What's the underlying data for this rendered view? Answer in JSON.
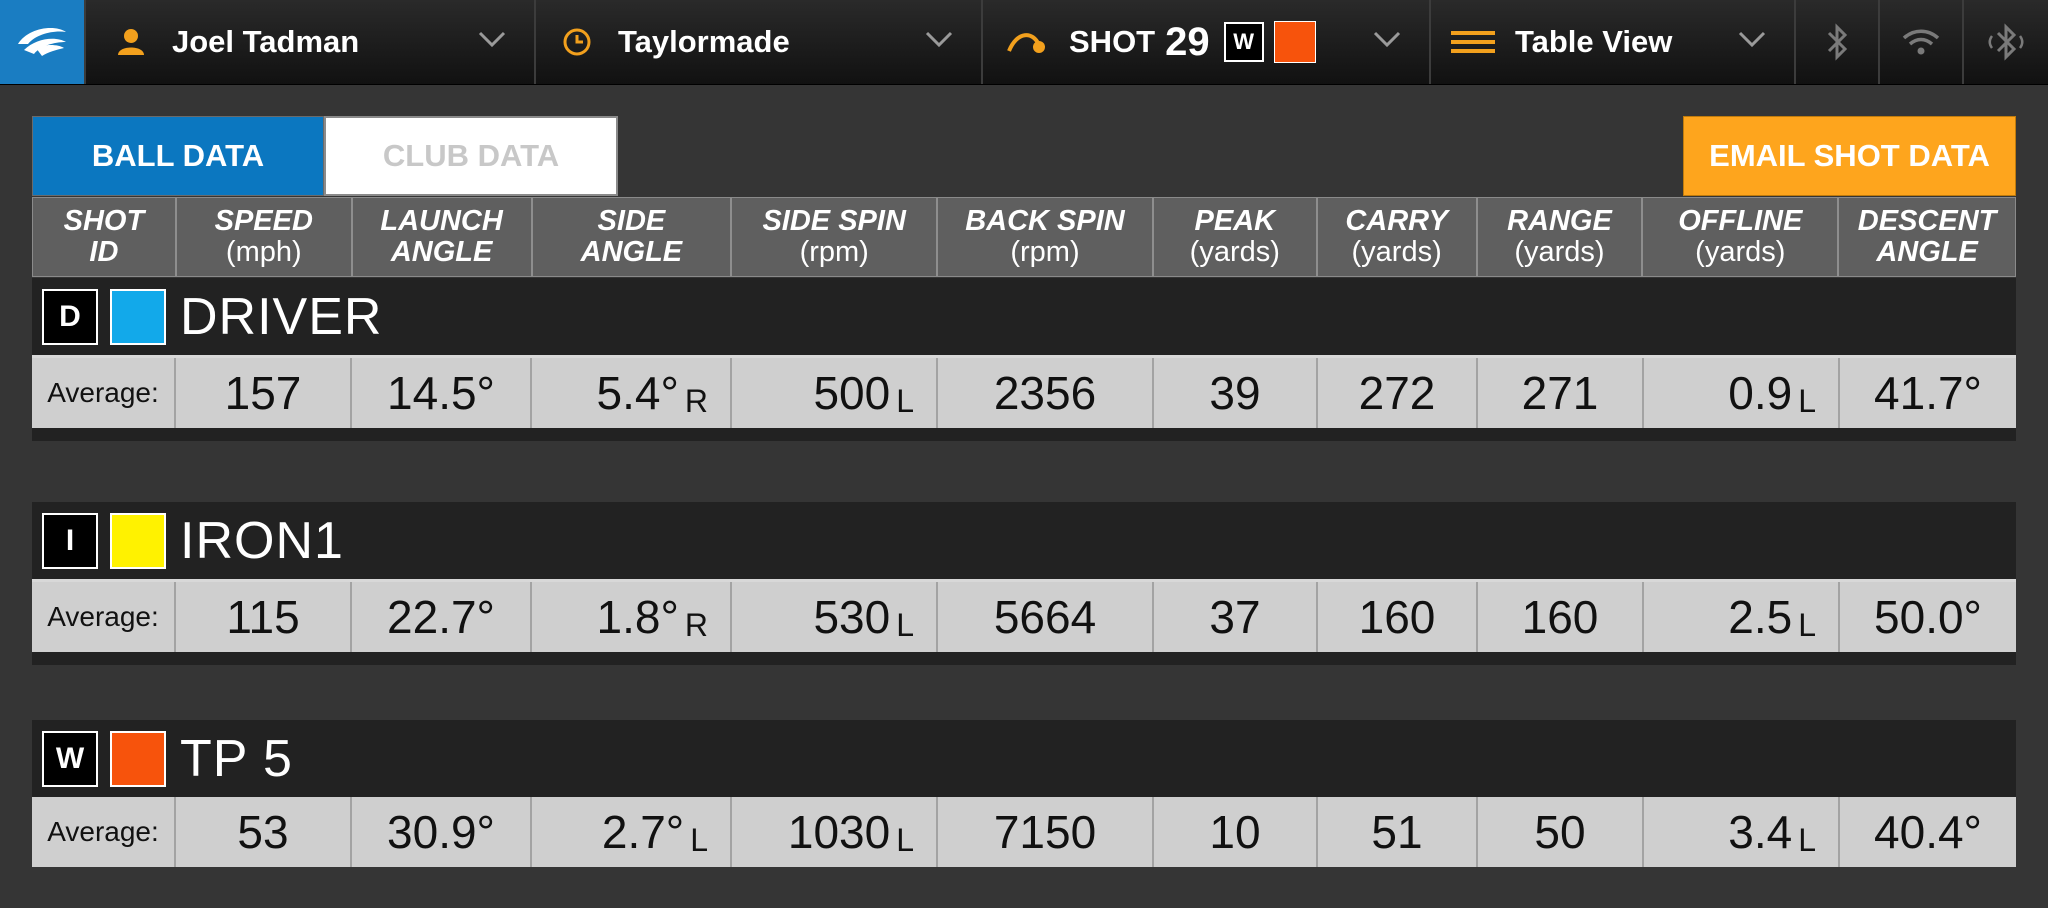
{
  "topbar": {
    "user_name": "Joel Tadman",
    "session_name": "Taylormade",
    "shot_label": "SHOT",
    "shot_number": "29",
    "shot_club_id": "W",
    "view_name": "Table View"
  },
  "tabs": {
    "ball": "BALL DATA",
    "club": "CLUB DATA"
  },
  "email_button": "EMAIL SHOT DATA",
  "columns": [
    {
      "title": "SHOT",
      "unit": "ID"
    },
    {
      "title": "SPEED",
      "unit": "(mph)"
    },
    {
      "title": "LAUNCH",
      "unit": "ANGLE"
    },
    {
      "title": "SIDE",
      "unit": "ANGLE"
    },
    {
      "title": "SIDE SPIN",
      "unit": "(rpm)"
    },
    {
      "title": "BACK SPIN",
      "unit": "(rpm)"
    },
    {
      "title": "PEAK",
      "unit": "(yards)"
    },
    {
      "title": "CARRY",
      "unit": "(yards)"
    },
    {
      "title": "RANGE",
      "unit": "(yards)"
    },
    {
      "title": "OFFLINE",
      "unit": "(yards)"
    },
    {
      "title": "DESCENT",
      "unit": "ANGLE"
    }
  ],
  "clubs": [
    {
      "id": "D",
      "name": "DRIVER",
      "color": "#12a9ea",
      "average_label": "Average:",
      "speed": "157",
      "launch": "14.5°",
      "side_angle": "5.4°",
      "side_angle_dir": "R",
      "side_spin": "500",
      "side_spin_dir": "L",
      "back_spin": "2356",
      "peak": "39",
      "carry": "272",
      "range": "271",
      "offline": "0.9",
      "offline_dir": "L",
      "descent": "41.7°"
    },
    {
      "id": "I",
      "name": "IRON1",
      "color": "#fff200",
      "average_label": "Average:",
      "speed": "115",
      "launch": "22.7°",
      "side_angle": "1.8°",
      "side_angle_dir": "R",
      "side_spin": "530",
      "side_spin_dir": "L",
      "back_spin": "5664",
      "peak": "37",
      "carry": "160",
      "range": "160",
      "offline": "2.5",
      "offline_dir": "L",
      "descent": "50.0°"
    },
    {
      "id": "W",
      "name": "TP 5",
      "color": "#f7530c",
      "average_label": "Average:",
      "speed": "53",
      "launch": "30.9°",
      "side_angle": "2.7°",
      "side_angle_dir": "L",
      "side_spin": "1030",
      "side_spin_dir": "L",
      "back_spin": "7150",
      "peak": "10",
      "carry": "51",
      "range": "50",
      "offline": "3.4",
      "offline_dir": "L",
      "descent": "40.4°"
    }
  ],
  "colors": {
    "accent_blue": "#0b77c0",
    "email_orange": "#fea51d",
    "user_icon": "#f2a01d"
  }
}
